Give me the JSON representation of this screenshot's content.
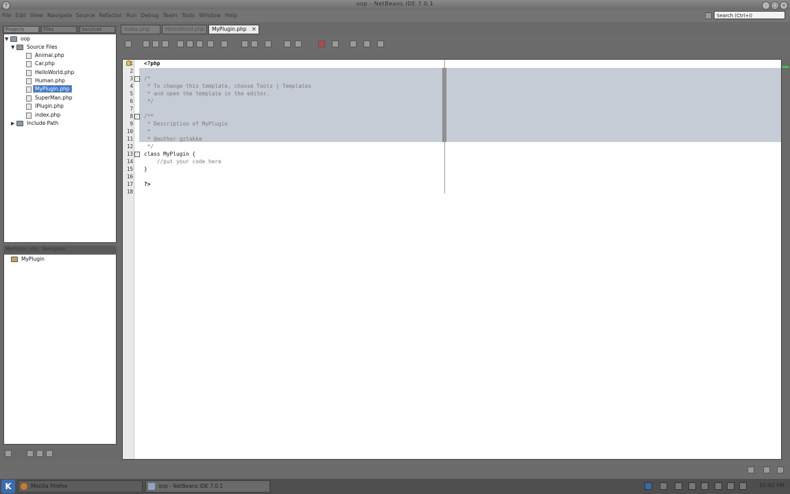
{
  "window": {
    "title": "oop - NetBeans IDE 7.0.1"
  },
  "menu": {
    "items": [
      "File",
      "Edit",
      "View",
      "Navigate",
      "Source",
      "Refactor",
      "Run",
      "Debug",
      "Team",
      "Tools",
      "Window",
      "Help"
    ]
  },
  "search": {
    "placeholder": "Search (Ctrl+I)"
  },
  "left_tabs": [
    "Projects",
    "Files",
    "Services"
  ],
  "project_tree": {
    "project": "oop",
    "source_folder": "Source Files",
    "files": [
      "Animal.php",
      "Car.php",
      "HelloWorld.php",
      "Human.php",
      "MyPlugin.php",
      "SuperMan.php",
      "IPlugin.php",
      "index.php"
    ],
    "selected": "MyPlugin.php",
    "include_path": "Include Path"
  },
  "navigator": {
    "title": "MyPlugin.php - Navigator",
    "items": [
      "MyPlugin"
    ]
  },
  "editor_tabs": [
    {
      "label": "index.php",
      "active": false
    },
    {
      "label": "HelloWorld.php",
      "active": false
    },
    {
      "label": "MyPlugin.php",
      "active": true
    }
  ],
  "code": {
    "line_numbers": [
      "1",
      "2",
      "3",
      "4",
      "5",
      "6",
      "7",
      "8",
      "9",
      "10",
      "11",
      "12",
      "13",
      "14",
      "15",
      "16",
      "17",
      "18"
    ],
    "lines": [
      "<?php",
      "",
      "/*",
      " * To change this template, choose Tools | Templates",
      " * and open the template in the editor.",
      " */",
      "",
      "/**",
      " * Description of MyPlugin",
      " *",
      " * @author gztakka",
      " */",
      "class MyPlugin {",
      "    //put your code here",
      "}",
      "",
      "?>",
      ""
    ]
  },
  "taskbar": {
    "start": "K",
    "tasks": [
      "Mozilla Firefox",
      "oop - NetBeans IDE 7.0.1"
    ],
    "clock": "10:42 PM"
  },
  "colors": {
    "selection": "#c6ccd5",
    "tree_selection": "#3d78cf"
  }
}
